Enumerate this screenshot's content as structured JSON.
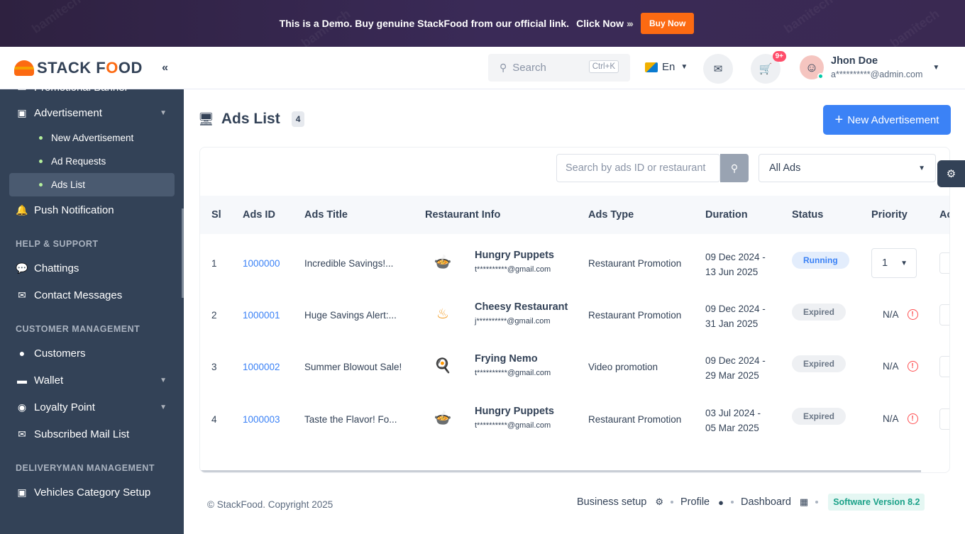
{
  "banner": {
    "text": "This is a Demo. Buy genuine StackFood from our official link.",
    "click_text": "Click Now",
    "arrows": "›››",
    "buy_label": "Buy Now"
  },
  "logo": {
    "part1": "STACK F",
    "part2": "O",
    "part3": "OD"
  },
  "collapse_icon": "«",
  "sidebar": {
    "promo_banner": "Promotional Banner",
    "advertisement": "Advertisement",
    "sub_items": [
      "New Advertisement",
      "Ad Requests",
      "Ads List"
    ],
    "push_notification": "Push Notification",
    "section_help": "HELP & SUPPORT",
    "chattings": "Chattings",
    "contact_messages": "Contact Messages",
    "section_customer": "CUSTOMER MANAGEMENT",
    "customers": "Customers",
    "wallet": "Wallet",
    "loyalty_point": "Loyalty Point",
    "subscribed_mail": "Subscribed Mail List",
    "section_deliveryman": "DELIVERYMAN MANAGEMENT",
    "vehicles": "Vehicles Category Setup"
  },
  "header": {
    "search_placeholder": "Search",
    "shortcut": "Ctrl+K",
    "language": "En",
    "cart_badge": "9+",
    "user_name": "Jhon Doe",
    "user_email": "a**********@admin.com"
  },
  "page": {
    "title": "Ads List",
    "count": "4",
    "new_button": "New Advertisement"
  },
  "filters": {
    "search_placeholder": "Search by ads ID or restaurant",
    "select_value": "All Ads"
  },
  "table": {
    "headers": [
      "Sl",
      "Ads ID",
      "Ads Title",
      "Restaurant Info",
      "Ads Type",
      "Duration",
      "Status",
      "Priority",
      "Ac"
    ],
    "rows": [
      {
        "sl": "1",
        "id": "1000000",
        "title": "Incredible Savings!...",
        "restaurant": "Hungry Puppets",
        "email": "t**********@gmail.com",
        "type": "Restaurant Promotion",
        "dur1": "09 Dec 2024 -",
        "dur2": "13 Jun 2025",
        "status": "Running",
        "priority": "1"
      },
      {
        "sl": "2",
        "id": "1000001",
        "title": "Huge Savings Alert:...",
        "restaurant": "Cheesy Restaurant",
        "email": "j**********@gmail.com",
        "type": "Restaurant Promotion",
        "dur1": "09 Dec 2024 -",
        "dur2": "31 Jan 2025",
        "status": "Expired",
        "priority": "N/A"
      },
      {
        "sl": "3",
        "id": "1000002",
        "title": "Summer Blowout Sale!",
        "restaurant": "Frying Nemo",
        "email": "t**********@gmail.com",
        "type": "Video promotion",
        "dur1": "09 Dec 2024 -",
        "dur2": "29 Mar 2025",
        "status": "Expired",
        "priority": "N/A"
      },
      {
        "sl": "4",
        "id": "1000003",
        "title": "Taste the Flavor! Fo...",
        "restaurant": "Hungry Puppets",
        "email": "t**********@gmail.com",
        "type": "Restaurant Promotion",
        "dur1": "03 Jul 2024 -",
        "dur2": "05 Mar 2025",
        "status": "Expired",
        "priority": "N/A"
      }
    ]
  },
  "footer": {
    "copyright": "© StackFood. Copyright 2025",
    "business_setup": "Business setup",
    "profile": "Profile",
    "dashboard": "Dashboard",
    "version": "Software Version 8.2"
  },
  "colors": {
    "accent": "#3b82f6",
    "sidebar": "#334257",
    "brand": "#fc6a12"
  }
}
